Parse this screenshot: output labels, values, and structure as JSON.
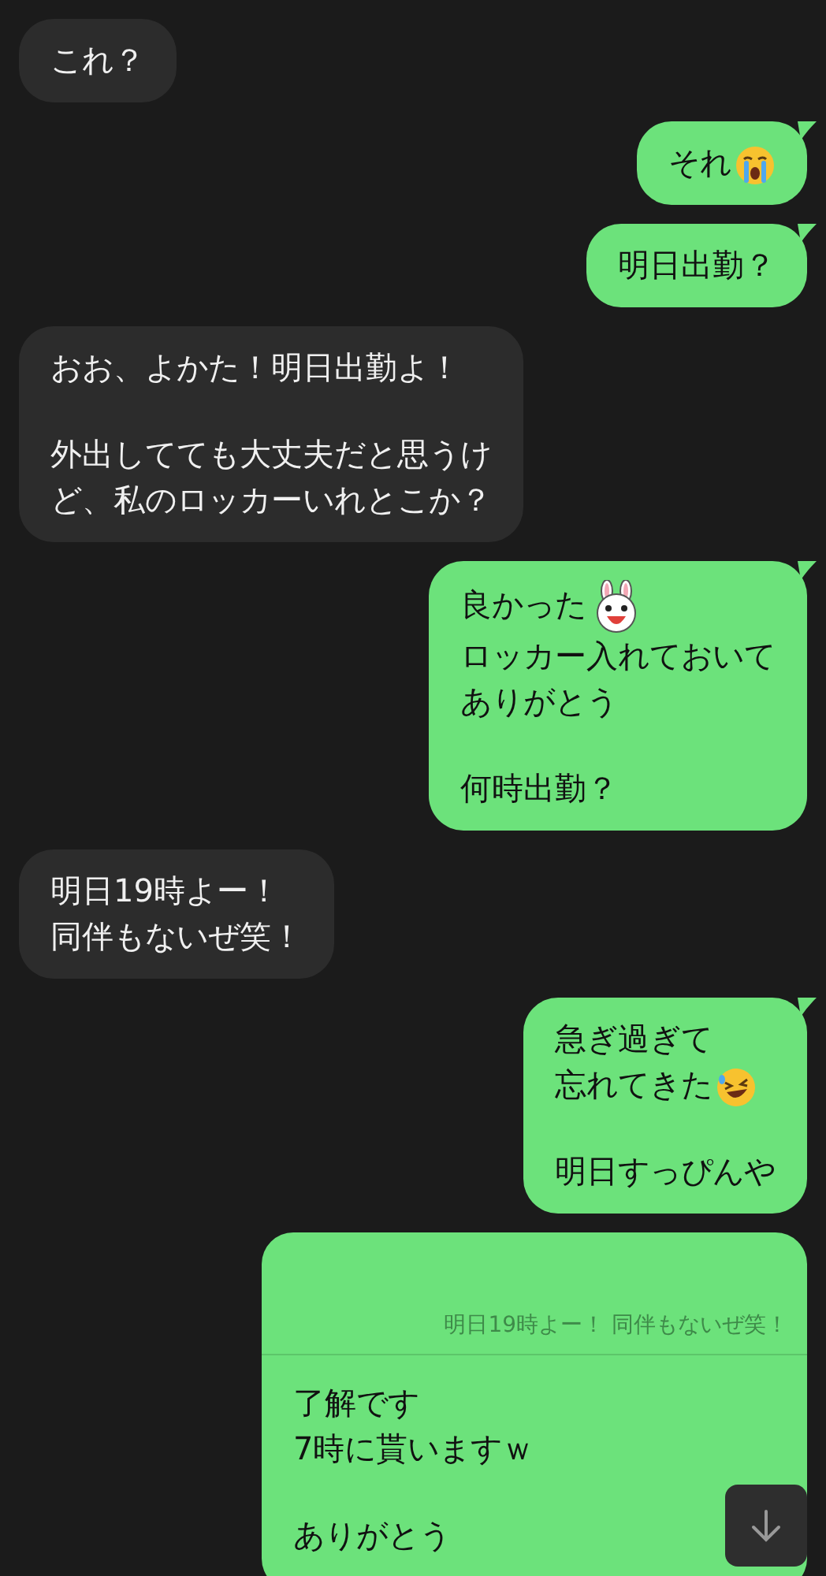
{
  "messages": [
    {
      "kind": "received",
      "paragraphs": [
        [
          {
            "kind": "plain",
            "text": "これ？"
          }
        ]
      ]
    },
    {
      "kind": "sent",
      "paragraphs": [
        [
          {
            "kind": "crying",
            "text": "それ"
          }
        ]
      ]
    },
    {
      "kind": "sent",
      "paragraphs": [
        [
          {
            "kind": "plain",
            "text": "明日出勤？"
          }
        ]
      ]
    },
    {
      "kind": "received",
      "paragraphs": [
        [
          {
            "kind": "plain",
            "text": "おお、よかた！明日出勤よ！"
          }
        ],
        [
          {
            "kind": "plain",
            "text": "外出してても大丈夫だと思うけ"
          },
          {
            "kind": "plain",
            "text": "ど、私のロッカーいれとこか？"
          }
        ]
      ]
    },
    {
      "kind": "sent",
      "paragraphs": [
        [
          {
            "kind": "rabbit",
            "text": "良かった"
          },
          {
            "kind": "plain",
            "text": "ロッカー入れておいて"
          },
          {
            "kind": "plain",
            "text": "ありがとう"
          }
        ],
        [
          {
            "kind": "plain",
            "text": "何時出勤？"
          }
        ]
      ]
    },
    {
      "kind": "received",
      "paragraphs": [
        [
          {
            "kind": "plain",
            "text": "明日19時よー！"
          },
          {
            "kind": "plain",
            "text": "同伴もないぜ笑！"
          }
        ]
      ]
    },
    {
      "kind": "sent",
      "paragraphs": [
        [
          {
            "kind": "plain",
            "text": "急ぎ過ぎて"
          },
          {
            "kind": "laughing",
            "text": "忘れてきた"
          }
        ],
        [
          {
            "kind": "plain",
            "text": "明日すっぴんや"
          }
        ]
      ]
    },
    {
      "kind": "sent",
      "quote": "明日19時よー！ 同伴もないぜ笑！",
      "paragraphs": [
        [
          {
            "kind": "plain",
            "text": "了解です"
          },
          {
            "kind": "plain",
            "text": "7時に貰いますｗ"
          }
        ],
        [
          {
            "kind": "plain",
            "text": "ありがとう"
          }
        ]
      ]
    }
  ]
}
